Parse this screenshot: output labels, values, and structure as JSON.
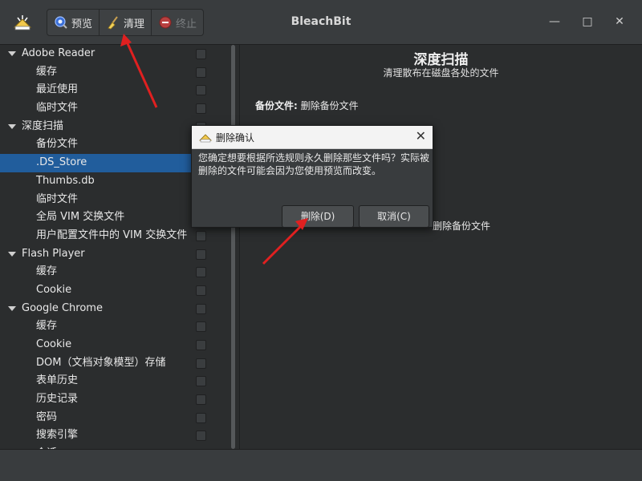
{
  "window": {
    "title": "BleachBit",
    "buttons": {
      "minimize": "—",
      "maximize": "□",
      "close": "✕"
    }
  },
  "toolbar": {
    "preview_label": "预览",
    "clean_label": "清理",
    "stop_label": "终止"
  },
  "tree": {
    "rows": [
      {
        "label": "Adobe Reader",
        "type": "category"
      },
      {
        "label": "缓存",
        "type": "item"
      },
      {
        "label": "最近使用",
        "type": "item"
      },
      {
        "label": "临时文件",
        "type": "item"
      },
      {
        "label": "深度扫描",
        "type": "category"
      },
      {
        "label": "备份文件",
        "type": "item"
      },
      {
        "label": ".DS_Store",
        "type": "item",
        "selected": true
      },
      {
        "label": "Thumbs.db",
        "type": "item"
      },
      {
        "label": "临时文件",
        "type": "item"
      },
      {
        "label": "全局 VIM 交换文件",
        "type": "item"
      },
      {
        "label": "用户配置文件中的 VIM 交换文件",
        "type": "item"
      },
      {
        "label": "Flash Player",
        "type": "category"
      },
      {
        "label": "缓存",
        "type": "item"
      },
      {
        "label": "Cookie",
        "type": "item"
      },
      {
        "label": "Google Chrome",
        "type": "category"
      },
      {
        "label": "缓存",
        "type": "item"
      },
      {
        "label": "Cookie",
        "type": "item"
      },
      {
        "label": "DOM（文档对象模型）存储",
        "type": "item"
      },
      {
        "label": "表单历史",
        "type": "item"
      },
      {
        "label": "历史记录",
        "type": "item"
      },
      {
        "label": "密码",
        "type": "item"
      },
      {
        "label": "搜索引擎",
        "type": "item"
      },
      {
        "label": "会话",
        "type": "item"
      }
    ]
  },
  "content": {
    "title": "深度扫描",
    "subtitle": "清理散布在磁盘各处的文件",
    "line1_key": "备份文件:",
    "line1_value": "删除备份文件",
    "line2_fragment": "删除备份文件"
  },
  "dialog": {
    "title": "删除确认",
    "message": "您确定想要根据所选规则永久删除那些文件吗？实际被删除的文件可能会因为您使用预览而改变。",
    "delete_label": "删除(D)",
    "cancel_label": "取消(C)",
    "close": "✕"
  },
  "colors": {
    "selection": "#215d9c",
    "annotation_arrow": "#e02020"
  }
}
